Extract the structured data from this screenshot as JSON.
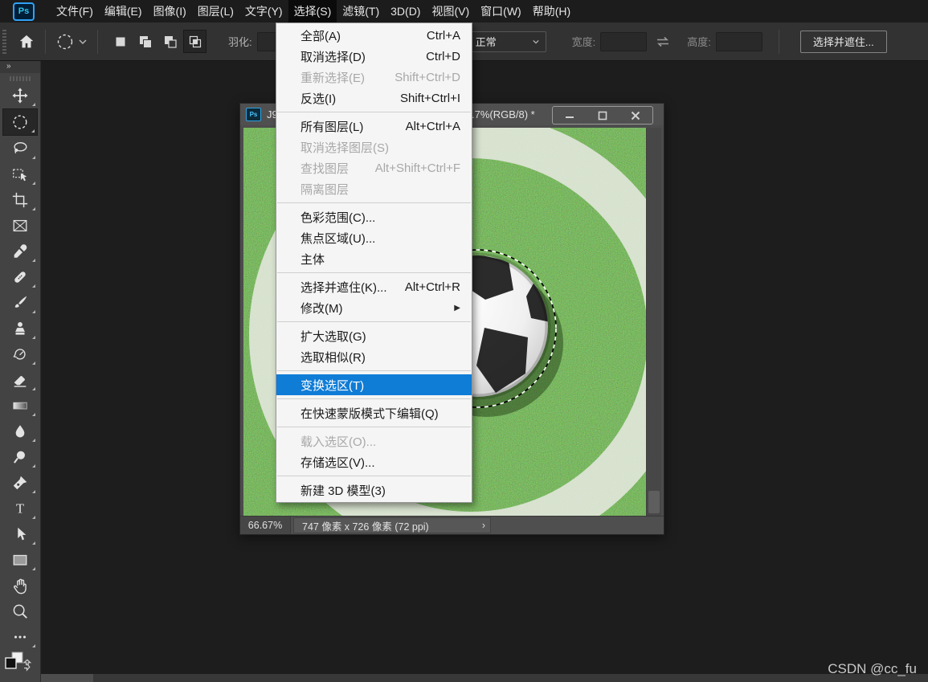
{
  "app": {
    "logo_text": "Ps"
  },
  "menubar": {
    "items": [
      {
        "label": "文件(F)"
      },
      {
        "label": "编辑(E)"
      },
      {
        "label": "图像(I)"
      },
      {
        "label": "图层(L)"
      },
      {
        "label": "文字(Y)"
      },
      {
        "label": "选择(S)",
        "state": "active"
      },
      {
        "label": "滤镜(T)"
      },
      {
        "label": "3D(D)"
      },
      {
        "label": "视图(V)"
      },
      {
        "label": "窗口(W)"
      },
      {
        "label": "帮助(H)"
      }
    ]
  },
  "options_bar": {
    "feather_label": "羽化:",
    "feather_value": "",
    "mode_value": "正常",
    "width_label": "宽度:",
    "width_value": "",
    "height_label": "高度:",
    "height_value": "",
    "select_and_mask_button": "选择并遮住..."
  },
  "toolbar": {
    "collapse_glyph": "»",
    "tools": [
      "move",
      "elliptical-marquee",
      "lasso",
      "object-selection",
      "crop",
      "frame",
      "eyedropper",
      "spot-healing-brush",
      "brush",
      "clone-stamp",
      "history-brush",
      "eraser",
      "gradient",
      "blur",
      "dodge",
      "pen",
      "type",
      "path-selection",
      "rectangle",
      "hand",
      "zoom",
      "edit-toolbar"
    ],
    "active_tool": "elliptical-marquee"
  },
  "select_menu": {
    "items": [
      {
        "label": "全部(A)",
        "shortcut": "Ctrl+A"
      },
      {
        "label": "取消选择(D)",
        "shortcut": "Ctrl+D"
      },
      {
        "label": "重新选择(E)",
        "shortcut": "Shift+Ctrl+D",
        "state": "disabled"
      },
      {
        "label": "反选(I)",
        "shortcut": "Shift+Ctrl+I"
      },
      {
        "label": "所有图层(L)",
        "shortcut": "Alt+Ctrl+A"
      },
      {
        "label": "取消选择图层(S)",
        "shortcut": "",
        "state": "disabled"
      },
      {
        "label": "查找图层",
        "shortcut": "Alt+Shift+Ctrl+F",
        "state": "disabled"
      },
      {
        "label": "隔离图层",
        "shortcut": "",
        "state": "disabled"
      },
      {
        "label": "色彩范围(C)...",
        "shortcut": ""
      },
      {
        "label": "焦点区域(U)...",
        "shortcut": ""
      },
      {
        "label": "主体",
        "shortcut": ""
      },
      {
        "label": "选择并遮住(K)...",
        "shortcut": "Alt+Ctrl+R"
      },
      {
        "label": "修改(M)",
        "shortcut": "",
        "submenu_arrow": "▶"
      },
      {
        "label": "扩大选取(G)",
        "shortcut": ""
      },
      {
        "label": "选取相似(R)",
        "shortcut": ""
      },
      {
        "label": "变换选区(T)",
        "shortcut": "",
        "state": "highlighted"
      },
      {
        "label": "在快速蒙版模式下编辑(Q)",
        "shortcut": ""
      },
      {
        "label": "载入选区(O)...",
        "shortcut": "",
        "state": "disabled"
      },
      {
        "label": "存储选区(V)...",
        "shortcut": ""
      },
      {
        "label": "新建 3D 模型(3)",
        "shortcut": ""
      }
    ]
  },
  "document_window": {
    "file_icon_text": "Ps",
    "title_left": "J9",
    "title_right": ".7%(RGB/8) *",
    "status": {
      "zoom_level": "66.67%",
      "dimensions": "747 像素 x 726 像素 (72 ppi)",
      "expander": "›"
    }
  },
  "watermark": "CSDN @cc_fu",
  "colors": {
    "menu_highlight": "#0f7cd6",
    "menu_bg": "#f5f5f5",
    "app_dark": "#1d1d1d",
    "options_bar": "#323232",
    "toolbar": "#434343",
    "window_chrome": "#4f4f4f",
    "grass_green": "#3f7c1e"
  }
}
